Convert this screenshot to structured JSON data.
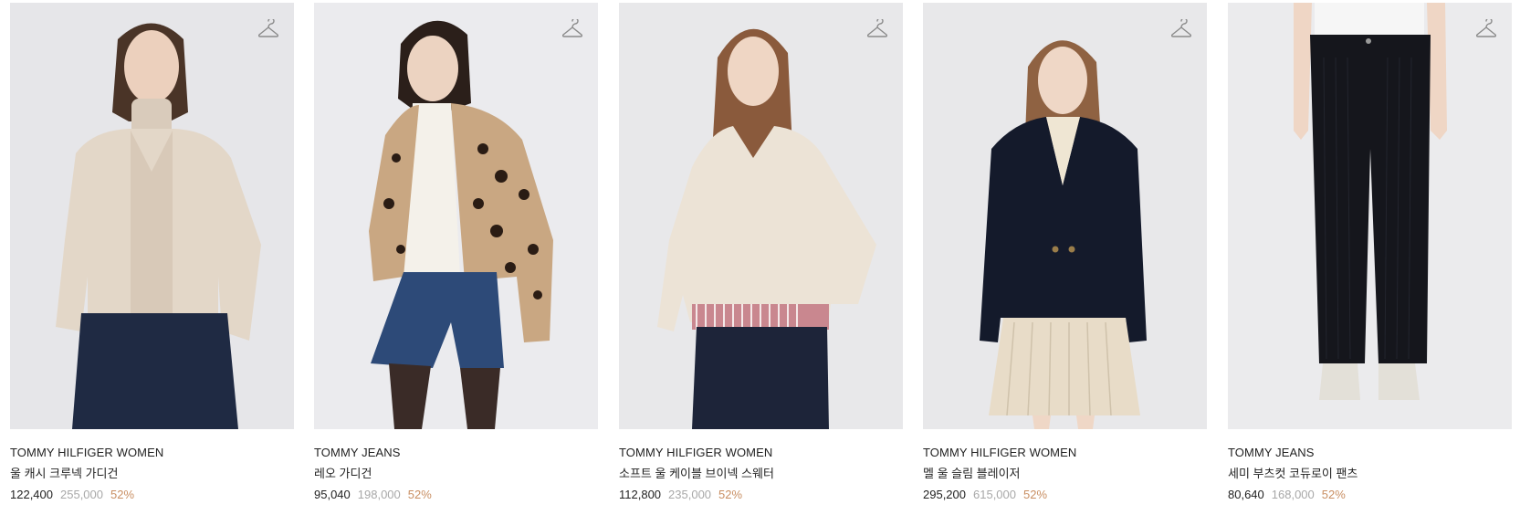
{
  "products": [
    {
      "brand": "TOMMY HILFIGER WOMEN",
      "name": "울 캐시 크루넥 가디건",
      "sale_price": "122,400",
      "original_price": "255,000",
      "discount": "52%"
    },
    {
      "brand": "TOMMY JEANS",
      "name": "레오 가디건",
      "sale_price": "95,040",
      "original_price": "198,000",
      "discount": "52%"
    },
    {
      "brand": "TOMMY HILFIGER WOMEN",
      "name": "소프트 울 케이블 브이넥 스웨터",
      "sale_price": "112,800",
      "original_price": "235,000",
      "discount": "52%"
    },
    {
      "brand": "TOMMY HILFIGER WOMEN",
      "name": "멜 울 슬림 블레이저",
      "sale_price": "295,200",
      "original_price": "615,000",
      "discount": "52%"
    },
    {
      "brand": "TOMMY JEANS",
      "name": "세미 부츠컷 코듀로이 팬츠",
      "sale_price": "80,640",
      "original_price": "168,000",
      "discount": "52%"
    }
  ],
  "icons": {
    "wishlist": "hanger-icon"
  },
  "colors": {
    "photo_bg": "#e9e9eb",
    "text": "#222222",
    "original_price": "#a8a8a8",
    "discount": "#c98f63"
  }
}
